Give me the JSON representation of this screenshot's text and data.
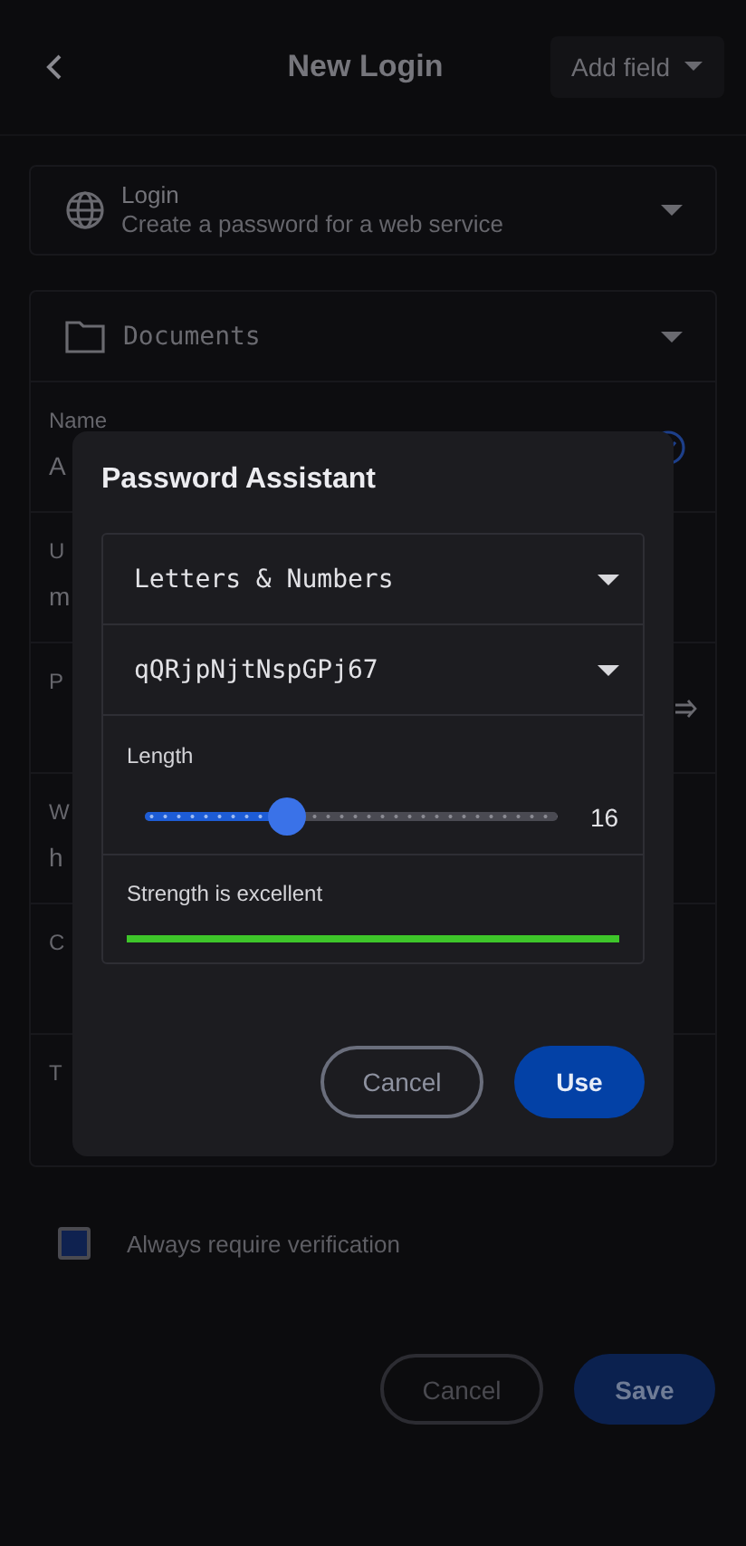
{
  "header": {
    "title": "New Login",
    "add_field": "Add field"
  },
  "type_select": {
    "title": "Login",
    "subtitle": "Create a password for a web service"
  },
  "folder": "Documents",
  "fields": [
    {
      "kind": "name",
      "label": "Name",
      "value": "A"
    },
    {
      "kind": "text",
      "label": "U",
      "value": "m"
    },
    {
      "kind": "password",
      "label": "P"
    },
    {
      "kind": "text",
      "label": "W",
      "value": "h"
    },
    {
      "kind": "text",
      "label": "C"
    },
    {
      "kind": "text",
      "label": "T"
    }
  ],
  "verification": {
    "label": "Always require verification",
    "checked": false
  },
  "footer": {
    "cancel": "Cancel",
    "save": "Save"
  },
  "dialog": {
    "title": "Password Assistant",
    "mode": "Letters & Numbers",
    "password": "qQRjpNjtNspGPj67",
    "length_label": "Length",
    "length": {
      "level": 0.33
    },
    "length_value": "16",
    "strength_label": "Strength is excellent",
    "strength": {
      "level": 1
    },
    "cancel": "Cancel",
    "use": "Use"
  }
}
